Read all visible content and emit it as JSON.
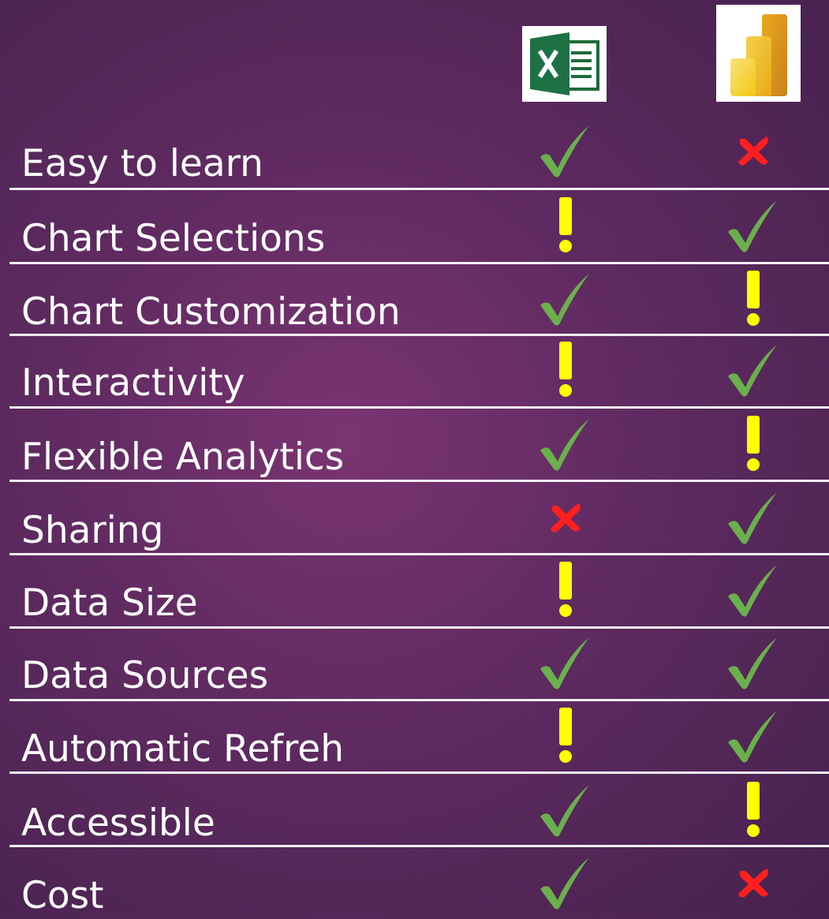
{
  "tools": [
    {
      "name": "Excel",
      "icon": "excel-logo"
    },
    {
      "name": "Power BI",
      "icon": "power-bi-logo"
    }
  ],
  "legend": {
    "check": "check-icon",
    "warning": "exclamation-icon",
    "cross": "cross-icon"
  },
  "colors": {
    "check": "#6ab04c",
    "warning": "#ffff00",
    "cross": "#ff1f1f",
    "text": "#ffffff",
    "background": "#5e2a60"
  },
  "rows": [
    {
      "label": "Easy to learn",
      "excel": "check",
      "powerbi": "cross"
    },
    {
      "label": "Chart Selections",
      "excel": "warning",
      "powerbi": "check"
    },
    {
      "label": "Chart Customization",
      "excel": "check",
      "powerbi": "warning"
    },
    {
      "label": "Interactivity",
      "excel": "warning",
      "powerbi": "check"
    },
    {
      "label": "Flexible Analytics",
      "excel": "check",
      "powerbi": "warning"
    },
    {
      "label": "Sharing",
      "excel": "cross",
      "powerbi": "check"
    },
    {
      "label": "Data Size",
      "excel": "warning",
      "powerbi": "check"
    },
    {
      "label": "Data Sources",
      "excel": "check",
      "powerbi": "check"
    },
    {
      "label": "Automatic Refreh",
      "excel": "warning",
      "powerbi": "check"
    },
    {
      "label": "Accessible",
      "excel": "check",
      "powerbi": "warning"
    },
    {
      "label": "Cost",
      "excel": "check",
      "powerbi": "cross"
    }
  ]
}
